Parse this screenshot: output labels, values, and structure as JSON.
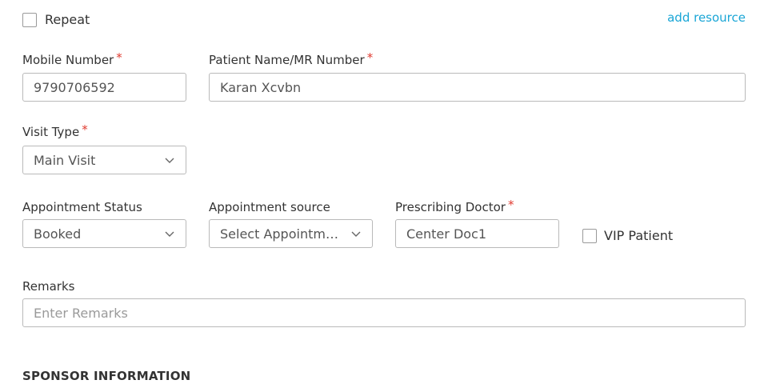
{
  "repeat": {
    "label": "Repeat",
    "checked": false
  },
  "add_resource_link": "add resource",
  "mobile": {
    "label": "Mobile Number",
    "required_mark": "*",
    "value": "9790706592"
  },
  "patient": {
    "label": "Patient Name/MR Number",
    "required_mark": "*",
    "value": "Karan Xcvbn"
  },
  "visit_type": {
    "label": "Visit Type",
    "required_mark": "*",
    "selected": "Main Visit"
  },
  "appointment_status": {
    "label": "Appointment Status",
    "selected": "Booked"
  },
  "appointment_source": {
    "label": "Appointment source",
    "selected": "Select Appointm…"
  },
  "prescribing_doctor": {
    "label": "Prescribing Doctor",
    "required_mark": "*",
    "value": "Center Doc1"
  },
  "vip_patient": {
    "label": "VIP Patient",
    "checked": false
  },
  "remarks": {
    "label": "Remarks",
    "placeholder": "Enter Remarks",
    "value": ""
  },
  "sponsor_section": {
    "title": "SPONSOR INFORMATION"
  },
  "colors": {
    "link": "#1aa6d6",
    "required": "#e03a2f",
    "border": "#b9b9b9"
  }
}
